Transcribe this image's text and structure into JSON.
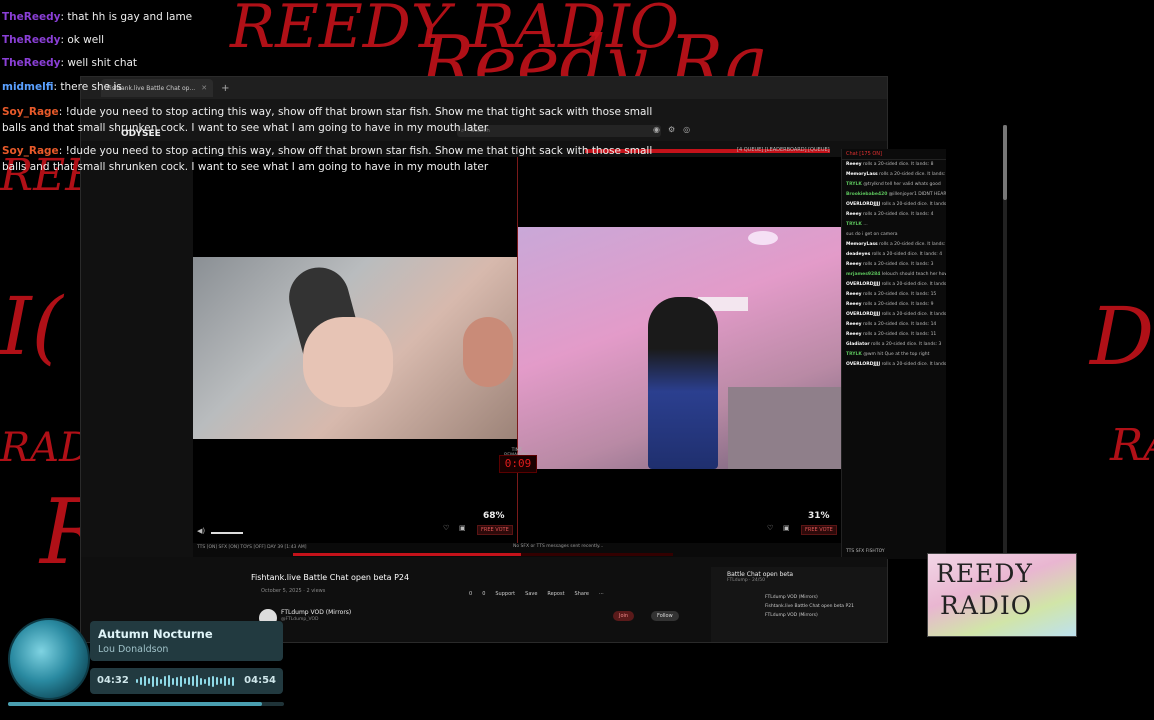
{
  "overlay_chat": [
    {
      "user": "TheReedy",
      "user_color": "purple",
      "text": ": that hh is gay and lame"
    },
    {
      "user": "TheReedy",
      "user_color": "purple",
      "text": ": ok well"
    },
    {
      "user": "TheReedy",
      "user_color": "purple",
      "text": ": well shit chat"
    },
    {
      "user": "midmelfi",
      "user_color": "blue",
      "text": ": there she is"
    },
    {
      "user": "Soy_Rage",
      "user_color": "red",
      "text": ": !dude you need to stop acting this way, show off that brown star fish. Show me that tight sack with those small"
    },
    {
      "user": "",
      "user_color": "red",
      "text": "balls and that small shrunken cock. I want to see what I am going to have in my mouth later"
    },
    {
      "user": "Soy_Rage",
      "user_color": "red",
      "text": ": !dude you need to stop acting this way, show off that brown star fish. Show me that tight sack with those small"
    },
    {
      "user": "",
      "user_color": "red",
      "text": "balls and that small shrunken cock. I want to see what I am going to have in my mouth later"
    }
  ],
  "browser": {
    "tab_title": "Fishtank.live Battle Chat op...",
    "search_placeholder": "Search",
    "logo": "ODYSEE",
    "top_links": "[4 QUEUE]   [LEADERBOARD]   [QUEUE]"
  },
  "battle": {
    "timer_label": "TIME REMAINING",
    "timer": "0:09",
    "left_pct": "68%",
    "right_pct": "31%",
    "free_vote": "FREE VOTE",
    "status_left": "TTS [ON]   SFX [ON]   TOYS [OFF]   DAY 39 [1:43 AM]",
    "status_mid": "No SFX or TTS messages sent recently..."
  },
  "chat_panel": {
    "header": "Chat [175 ON]",
    "messages": [
      {
        "user": "Reeey",
        "text": "rolls a 20-sided dice. It lands: 8"
      },
      {
        "user": "MemoryLass",
        "text": "rolls a 20-sided dice. It lands: 6"
      },
      {
        "user": "TRYLK",
        "text": "@trylknd tell her valid whats good",
        "green": true
      },
      {
        "user": "Brookiebabe420",
        "text": "@illenjoyer1 DIDNT HEAR ANYTHING IDK",
        "green": true
      },
      {
        "user": "OVERLORDJJJJ",
        "text": "rolls a 20-sided dice. It lands: 13"
      },
      {
        "user": "Reeey",
        "text": "rolls a 20-sided dice. It lands: 4"
      },
      {
        "user": "TRYLK",
        "text": "...",
        "green": true
      },
      {
        "user": "",
        "text": "sus do i get on camera"
      },
      {
        "user": "MemoryLass",
        "text": "rolls a 20-sided dice. It lands: 18"
      },
      {
        "user": "deadeyes",
        "text": "rolls a 20-sided dice. It lands: 4"
      },
      {
        "user": "Reeey",
        "text": "rolls a 20-sided dice. It lands: 3"
      },
      {
        "user": "mrjames9284",
        "text": "lelouch should teach her how to makeup",
        "green": true
      },
      {
        "user": "OVERLORDJJJJ",
        "text": "rolls a 20-sided dice. It lands: 17"
      },
      {
        "user": "Reeey",
        "text": "rolls a 20-sided dice. It lands: 15"
      },
      {
        "user": "Reeey",
        "text": "rolls a 20-sided dice. It lands: 9"
      },
      {
        "user": "OVERLORDJJJJ",
        "text": "rolls a 20-sided dice. It lands: 6"
      },
      {
        "user": "Reeey",
        "text": "rolls a 20-sided dice. It lands: 14"
      },
      {
        "user": "Reeey",
        "text": "rolls a 20-sided dice. It lands: 11"
      },
      {
        "user": "Gladiator",
        "text": "rolls a 20-sided dice. It lands: 3"
      },
      {
        "user": "TRYLK",
        "text": "@wm hit Que at the top right",
        "green": true
      },
      {
        "user": "OVERLORDJJJJ",
        "text": "rolls a 20-sided dice. It lands: 7"
      }
    ],
    "footer": "TTS   SFX   FISHTOY"
  },
  "youtube": {
    "title": "Fishtank.live Battle Chat open beta P24",
    "meta": "October 5, 2025   ·   2 views",
    "actions": [
      "0",
      "0",
      "Support",
      "Save",
      "Repost",
      "Share"
    ],
    "channel": "FTLdump VOD (Mirrors)",
    "channel_sub": "@FTLdump_VOD",
    "join": "Join",
    "follow": "Follow",
    "side_title": "Battle Chat open beta",
    "side_sub": "FTLdump · 24/50",
    "side_rows": [
      "FTLdump VOD (Mirrors)",
      "Fishtank.live Battle Chat open beta P21",
      "FTLdump VOD (Mirrors)"
    ]
  },
  "reedy_logo": {
    "line1": "REEDY",
    "line2": "RADIO"
  },
  "music": {
    "title": "Autumn Nocturne",
    "artist": "Lou Donaldson",
    "current": "04:32",
    "total": "04:54",
    "progress": 0.92
  },
  "background_scrawl": [
    "REEDY RADIO",
    "Reedy Ra",
    "REE",
    "RADIC",
    "RA",
    "R"
  ]
}
